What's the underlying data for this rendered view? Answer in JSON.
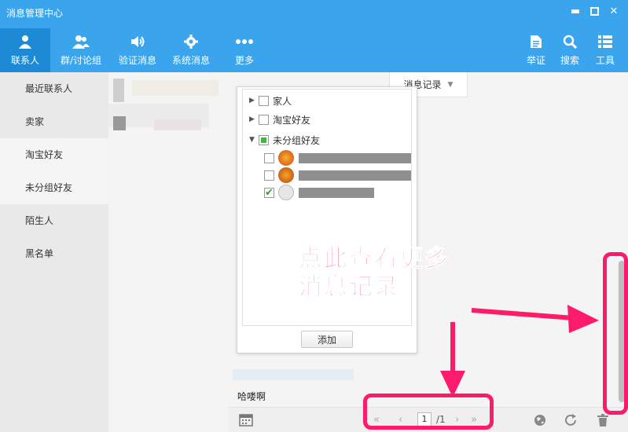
{
  "window": {
    "title": "消息管理中心"
  },
  "toolbar": {
    "left": [
      {
        "label": "联系人",
        "icon": "person-icon"
      },
      {
        "label": "群/讨论组",
        "icon": "group-icon"
      },
      {
        "label": "验证消息",
        "icon": "speaker-icon"
      },
      {
        "label": "系统消息",
        "icon": "gear-icon"
      },
      {
        "label": "更多",
        "icon": "more-icon"
      }
    ],
    "right": [
      {
        "label": "举证",
        "icon": "document-icon"
      },
      {
        "label": "搜索",
        "icon": "search-icon"
      },
      {
        "label": "工具",
        "icon": "list-icon"
      }
    ]
  },
  "sidebar": {
    "items": [
      {
        "label": "最近联系人"
      },
      {
        "label": "卖家"
      },
      {
        "label": "淘宝好友"
      },
      {
        "label": "未分组好友"
      },
      {
        "label": "陌生人"
      },
      {
        "label": "黑名单"
      }
    ]
  },
  "main": {
    "tab_label": "消息记录",
    "group_popup": {
      "groups": [
        {
          "label": "家人"
        },
        {
          "label": "淘宝好友"
        },
        {
          "label": "未分组好友"
        }
      ],
      "add_label": "添加"
    },
    "message_text": "哈喽啊"
  },
  "pager": {
    "current": "1",
    "total": "/1"
  },
  "annotation": {
    "line1": "点此查看更多",
    "line2": "消息记录"
  },
  "colors": {
    "toolbar_bg": "#3aa4ec",
    "toolbar_active": "#1e8ad6",
    "annotation": "#ff1b6b"
  }
}
